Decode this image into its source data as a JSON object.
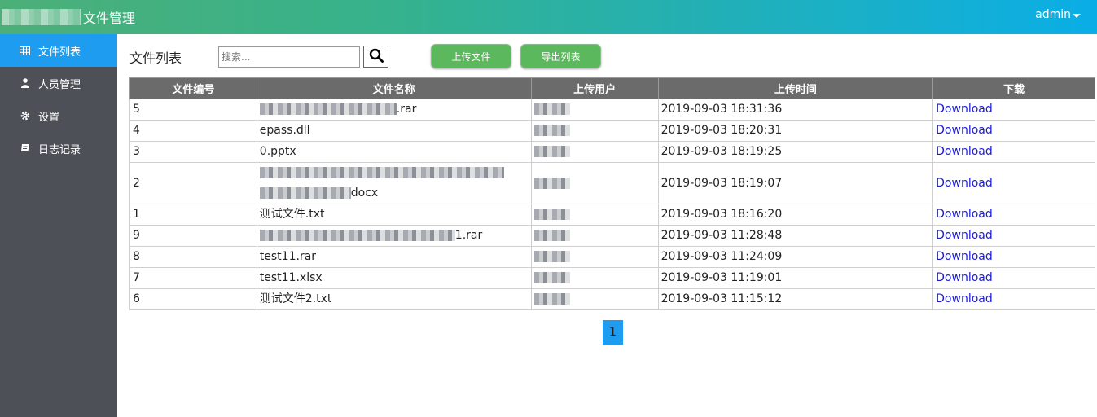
{
  "header": {
    "title": "文件管理",
    "user": "admin"
  },
  "sidebar": {
    "items": [
      {
        "label": "文件列表",
        "icon": "table-icon",
        "active": true
      },
      {
        "label": "人员管理",
        "icon": "user-icon",
        "active": false
      },
      {
        "label": "设置",
        "icon": "gear-icon",
        "active": false
      },
      {
        "label": "日志记录",
        "icon": "book-icon",
        "active": false
      }
    ]
  },
  "toolbar": {
    "title": "文件列表",
    "search_placeholder": "搜索...",
    "upload_label": "上传文件",
    "export_label": "导出列表"
  },
  "table": {
    "columns": [
      "文件编号",
      "文件名称",
      "上传用户",
      "上传时间",
      "下载"
    ],
    "rows": [
      {
        "id": "5",
        "name": ".rar",
        "user": "",
        "time": "2019-09-03 18:31:36",
        "download": "Download"
      },
      {
        "id": "4",
        "name": "epass.dll",
        "user": "",
        "time": "2019-09-03 18:20:31",
        "download": "Download"
      },
      {
        "id": "3",
        "name": "0.pptx",
        "user": "",
        "time": "2019-09-03 18:19:25",
        "download": "Download"
      },
      {
        "id": "2",
        "name": "docx",
        "user": "",
        "time": "2019-09-03 18:19:07",
        "download": "Download"
      },
      {
        "id": "1",
        "name": "测试文件.txt",
        "user": "",
        "time": "2019-09-03 18:16:20",
        "download": "Download"
      },
      {
        "id": "9",
        "name": "1.rar",
        "user": "",
        "time": "2019-09-03 11:28:48",
        "download": "Download"
      },
      {
        "id": "8",
        "name": "test11.rar",
        "user": "",
        "time": "2019-09-03 11:24:09",
        "download": "Download"
      },
      {
        "id": "7",
        "name": "test11.xlsx",
        "user": "",
        "time": "2019-09-03 11:19:01",
        "download": "Download"
      },
      {
        "id": "6",
        "name": "测试文件2.txt",
        "user": "",
        "time": "2019-09-03 11:15:12",
        "download": "Download"
      }
    ]
  },
  "pagination": {
    "current_page": "1"
  },
  "colors": {
    "active_nav": "#1e9cf0",
    "sidebar_bg": "#4d5057",
    "button_green": "#5cb85c",
    "header_gradient_start": "#4caf78",
    "header_gradient_end": "#0aaee6",
    "link": "#1a1ad6"
  }
}
